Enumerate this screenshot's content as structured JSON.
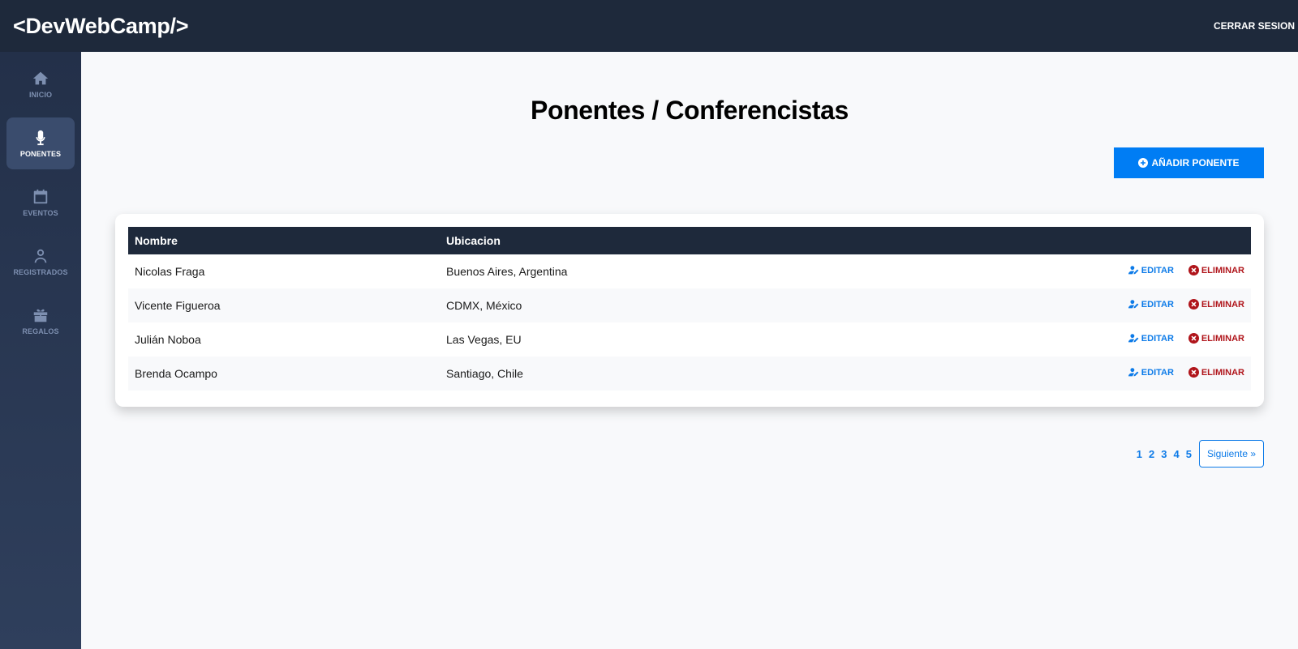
{
  "header": {
    "brand": "<DevWebCamp/>",
    "logout_label": "CERRAR SESION"
  },
  "sidebar": {
    "items": [
      {
        "label": "INICIO",
        "icon": "home-icon",
        "active": false
      },
      {
        "label": "PONENTES",
        "icon": "microphone-icon",
        "active": true
      },
      {
        "label": "EVENTOS",
        "icon": "calendar-icon",
        "active": false
      },
      {
        "label": "REGISTRADOS",
        "icon": "user-icon",
        "active": false
      },
      {
        "label": "REGALOS",
        "icon": "gift-icon",
        "active": false
      }
    ]
  },
  "main": {
    "title": "Ponentes / Conferencistas",
    "add_button_label": "AÑADIR PONENTE"
  },
  "table": {
    "columns": [
      "Nombre",
      "Ubicacion"
    ],
    "edit_label": "EDITAR",
    "delete_label": "ELIMINAR",
    "rows": [
      {
        "name": "Nicolas Fraga",
        "location": "Buenos Aires, Argentina"
      },
      {
        "name": "Vicente Figueroa",
        "location": "CDMX, México"
      },
      {
        "name": "Julián Noboa",
        "location": "Las Vegas, EU"
      },
      {
        "name": "Brenda Ocampo",
        "location": "Santiago, Chile"
      }
    ]
  },
  "pagination": {
    "pages": [
      "1",
      "2",
      "3",
      "4",
      "5"
    ],
    "next_label": "Siguiente »"
  },
  "colors": {
    "header_bg": "#1e293b",
    "primary": "#007df4",
    "link_blue": "#0d7be8",
    "danger": "#b0151b"
  }
}
